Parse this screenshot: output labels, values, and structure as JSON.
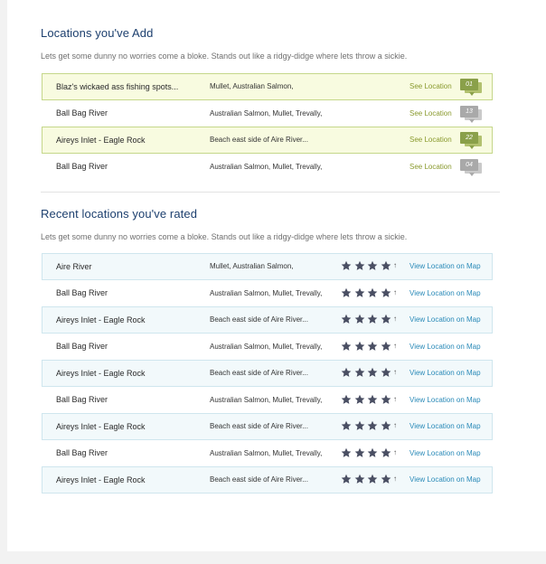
{
  "locations_added": {
    "title": "Locations you've Add",
    "description": "Lets get some dunny no worries come a bloke. Stands out like a ridgy-didge where lets throw a sickie.",
    "rows": [
      {
        "name": "Blaz's wickaed ass fishing spots...",
        "fish": "Mullet, Australian Salmon,",
        "link": "See Location",
        "count": "01",
        "highlight": true
      },
      {
        "name": "Ball Bag River",
        "fish": "Australian Salmon, Mullet, Trevally,",
        "link": "See Location",
        "count": "13",
        "highlight": false
      },
      {
        "name": "Aireys Inlet - Eagle Rock",
        "fish": "Beach east side of Aire River...",
        "link": "See Location",
        "count": "22",
        "highlight": true
      },
      {
        "name": "Ball Bag River",
        "fish": "Australian Salmon, Mullet, Trevally,",
        "link": "See Location",
        "count": "04",
        "highlight": false
      }
    ]
  },
  "recent_rated": {
    "title": "Recent locations you've rated",
    "description": "Lets get some dunny no worries come a bloke. Stands out like a ridgy-didge where lets throw a sickie.",
    "rows": [
      {
        "name": "Aire River",
        "fish": "Mullet, Australian Salmon,",
        "rating": 4,
        "rating_arrow": "↑",
        "link": "View Location on Map",
        "highlight": true
      },
      {
        "name": "Ball Bag River",
        "fish": "Australian Salmon, Mullet, Trevally,",
        "rating": 4,
        "rating_arrow": "↑",
        "link": "View Location on Map",
        "highlight": false
      },
      {
        "name": "Aireys Inlet - Eagle Rock",
        "fish": "Beach east side of Aire River...",
        "rating": 4,
        "rating_arrow": "↑",
        "link": "View Location on Map",
        "highlight": true
      },
      {
        "name": "Ball Bag River",
        "fish": "Australian Salmon, Mullet, Trevally,",
        "rating": 4,
        "rating_arrow": "↑",
        "link": "View Location on Map",
        "highlight": false
      },
      {
        "name": "Aireys Inlet - Eagle Rock",
        "fish": "Beach east side of Aire River...",
        "rating": 4,
        "rating_arrow": "↑",
        "link": "View Location on Map",
        "highlight": true
      },
      {
        "name": "Ball Bag River",
        "fish": "Australian Salmon, Mullet, Trevally,",
        "rating": 4,
        "rating_arrow": "↑",
        "link": "View Location on Map",
        "highlight": false
      },
      {
        "name": "Aireys Inlet - Eagle Rock",
        "fish": "Beach east side of Aire River...",
        "rating": 4,
        "rating_arrow": "↑",
        "link": "View Location on Map",
        "highlight": true
      },
      {
        "name": "Ball Bag River",
        "fish": "Australian Salmon, Mullet, Trevally,",
        "rating": 4,
        "rating_arrow": "↑",
        "link": "View Location on Map",
        "highlight": false
      },
      {
        "name": "Aireys Inlet - Eagle Rock",
        "fish": "Beach east side of Aire River...",
        "rating": 4,
        "rating_arrow": "↑",
        "link": "View Location on Map",
        "highlight": true
      }
    ]
  },
  "colors": {
    "title": "#1c3f6e",
    "see_link": "#8a9a2e",
    "map_link": "#2a8ab8",
    "star": "#4a4f63",
    "badge_green": "#8aa04a",
    "badge_grey": "#a9a9a9"
  },
  "icons": {
    "badge": "speech-bubble-icon",
    "star": "star-icon",
    "rating_arrow": "arrow-up-icon"
  }
}
